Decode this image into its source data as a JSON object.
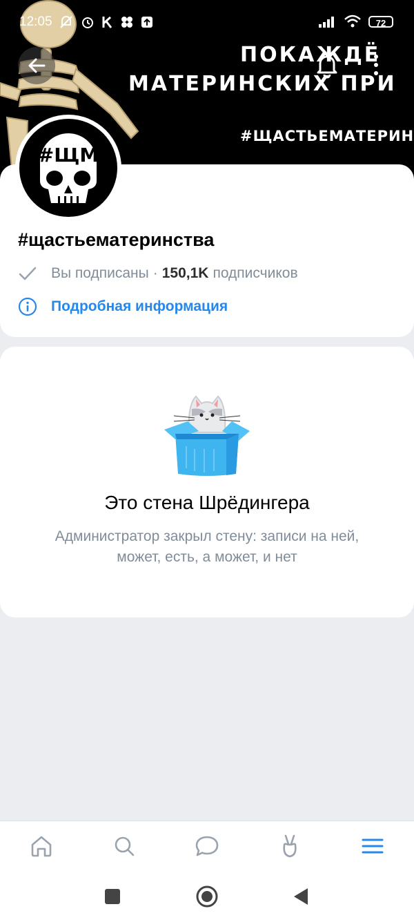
{
  "status_bar": {
    "time": "12:05",
    "battery": "72"
  },
  "cover": {
    "line1": "ПОКАЖДЁ",
    "line2": "МАТЕРИНСКИХ ПРИ",
    "hashtag": "#ЩАСТЬЕМАТЕРИН"
  },
  "avatar": {
    "label": "#ЩМ"
  },
  "profile": {
    "name": "#щастьематеринства",
    "subscribed_label": "Вы подписаны",
    "separator": "·",
    "subscribers_count": "150,1K",
    "subscribers_label": "подписчиков",
    "info_link": "Подробная информация"
  },
  "wall": {
    "title": "Это стена Шрёдингера",
    "text": "Администратор закрыл стену: записи на ней, может, есть, а может, и нет"
  },
  "colors": {
    "accent": "#2688eb",
    "secondary_text": "#818c99",
    "background": "#ebedf0",
    "box_blue": "#3fb5f0"
  },
  "tabs": [
    {
      "name": "home",
      "icon": "home-icon"
    },
    {
      "name": "search",
      "icon": "search-icon"
    },
    {
      "name": "messages",
      "icon": "chat-icon"
    },
    {
      "name": "clips",
      "icon": "clips-icon"
    },
    {
      "name": "menu",
      "icon": "menu-icon",
      "active": true
    }
  ]
}
